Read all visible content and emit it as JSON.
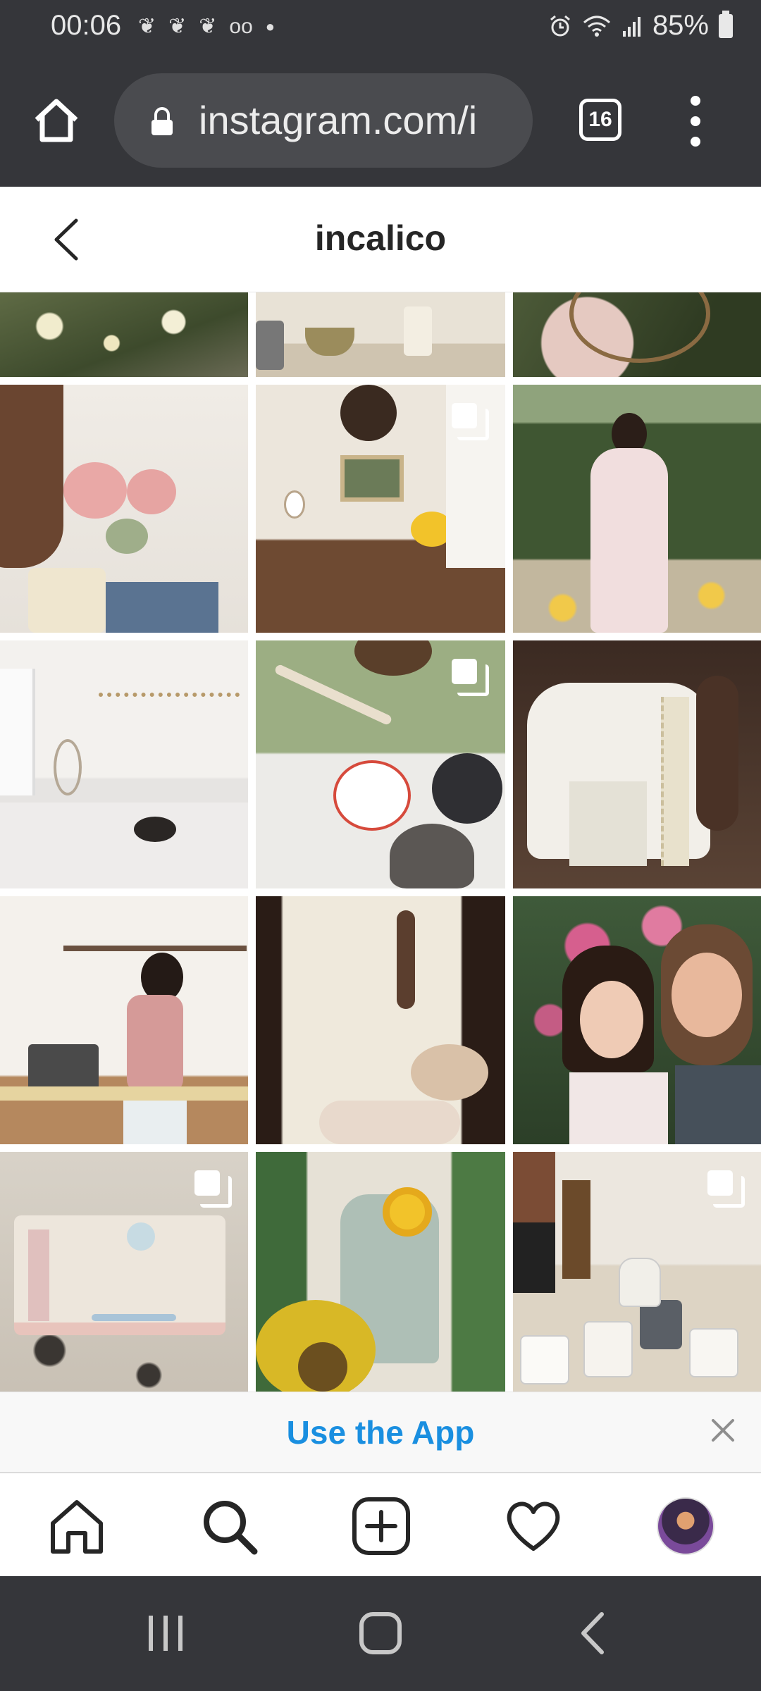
{
  "status_bar": {
    "time": "00:06",
    "battery": "85%",
    "left_icons": [
      "evernote-icon",
      "evernote-icon",
      "evernote-icon",
      "voicemail-icon",
      "dot-icon"
    ],
    "right_icons": [
      "alarm-icon",
      "wifi-icon",
      "signal-icon",
      "battery-icon"
    ]
  },
  "browser": {
    "url": "instagram.com/i",
    "tab_count": "16"
  },
  "header": {
    "title": "incalico"
  },
  "grid": {
    "tiles": [
      {
        "name": "post-flowers-garden",
        "multi": false
      },
      {
        "name": "post-kitchen-counter",
        "multi": false
      },
      {
        "name": "post-basket-flowers",
        "multi": false
      },
      {
        "name": "post-rose-sweatshirt",
        "multi": false
      },
      {
        "name": "post-desk-wall-decor",
        "multi": true
      },
      {
        "name": "post-floral-dress-garden",
        "multi": false
      },
      {
        "name": "post-bedroom",
        "multi": false
      },
      {
        "name": "post-strawberry-plate-cat",
        "multi": true
      },
      {
        "name": "post-lace-blouse",
        "multi": false
      },
      {
        "name": "post-kitchen-pink-sweater",
        "multi": false
      },
      {
        "name": "post-white-dress-flowers",
        "multi": false
      },
      {
        "name": "post-couple-selfie",
        "multi": false
      },
      {
        "name": "post-embroidered-book",
        "multi": true
      },
      {
        "name": "post-sunflowers",
        "multi": false
      },
      {
        "name": "post-mugs-collection",
        "multi": true
      }
    ]
  },
  "banner": {
    "text": "Use the App"
  },
  "colors": {
    "chrome_dark": "#35363a",
    "link_blue": "#1a8fe0",
    "text_dark": "#262626"
  }
}
